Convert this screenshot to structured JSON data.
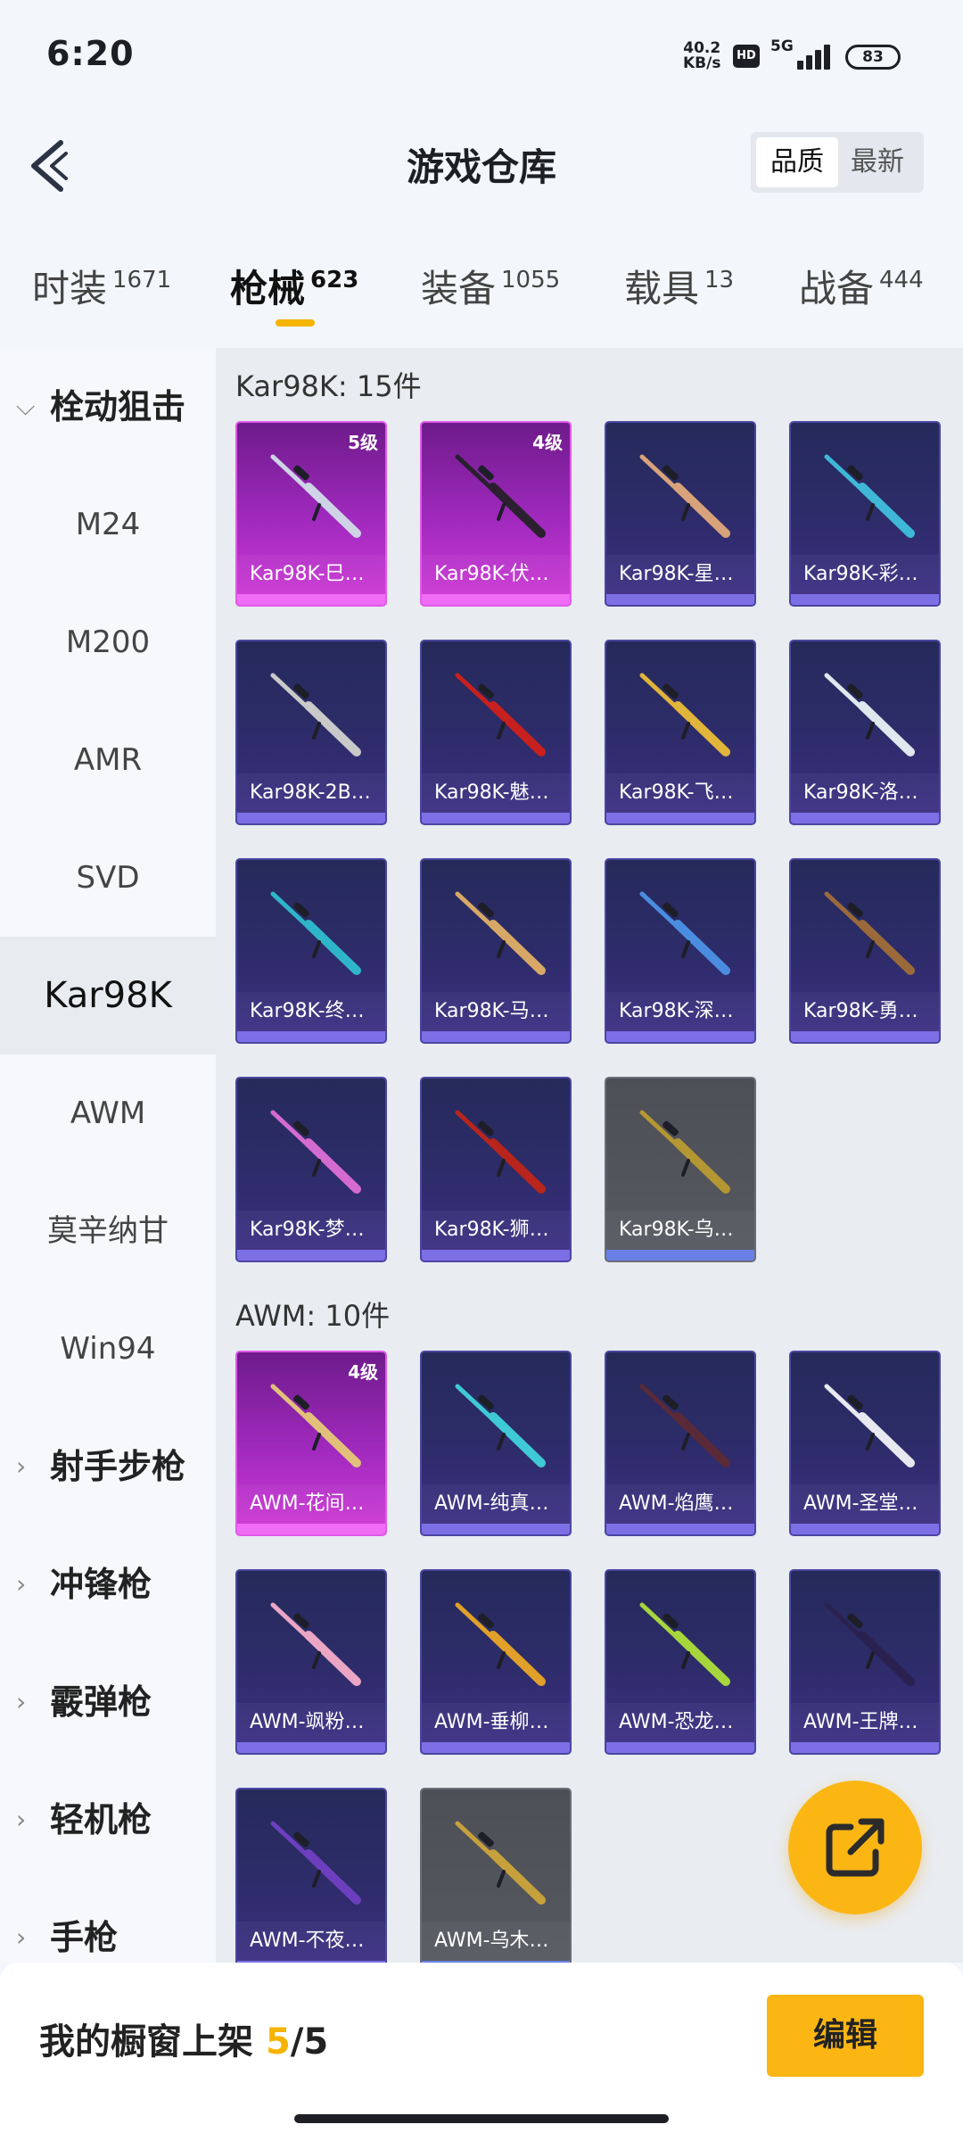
{
  "status": {
    "time": "6:20",
    "net_speed": "40.2",
    "net_unit": "KB/s",
    "hd": "HD",
    "gen": "5G",
    "battery": "83"
  },
  "header": {
    "title": "游戏仓库",
    "sort_quality": "品质",
    "sort_latest": "最新"
  },
  "tabs": [
    {
      "name": "时装",
      "count": "1671"
    },
    {
      "name": "枪械",
      "count": "623"
    },
    {
      "name": "装备",
      "count": "1055"
    },
    {
      "name": "载具",
      "count": "13"
    },
    {
      "name": "战备",
      "count": "444"
    }
  ],
  "active_tab": "枪械",
  "sidebar": {
    "items": [
      {
        "label": "栓动狙击",
        "group": true,
        "expanded": true
      },
      {
        "label": "M24"
      },
      {
        "label": "M200"
      },
      {
        "label": "AMR"
      },
      {
        "label": "SVD"
      },
      {
        "label": "Kar98K",
        "active": true
      },
      {
        "label": "AWM"
      },
      {
        "label": "莫辛纳甘"
      },
      {
        "label": "Win94"
      },
      {
        "label": "射手步枪",
        "group": true
      },
      {
        "label": "冲锋枪",
        "group": true
      },
      {
        "label": "霰弹枪",
        "group": true
      },
      {
        "label": "轻机枪",
        "group": true
      },
      {
        "label": "手枪",
        "group": true
      }
    ]
  },
  "sections": [
    {
      "title": "Kar98K: 15件",
      "items": [
        {
          "label": "Kar98K-巳…",
          "level": "5级",
          "rarity": "pink",
          "gun_color": "#cfd3e6"
        },
        {
          "label": "Kar98K-伏…",
          "level": "4级",
          "rarity": "pink",
          "gun_color": "#2a2030"
        },
        {
          "label": "Kar98K-星…",
          "rarity": "purple",
          "gun_color": "#d8a27a"
        },
        {
          "label": "Kar98K-彩…",
          "rarity": "purple",
          "gun_color": "#3fb8d8"
        },
        {
          "label": "Kar98K-2B…",
          "rarity": "purple",
          "gun_color": "#c9c9c9"
        },
        {
          "label": "Kar98K-魅…",
          "rarity": "purple",
          "gun_color": "#c8201e"
        },
        {
          "label": "Kar98K-飞…",
          "rarity": "purple",
          "gun_color": "#e1b43a"
        },
        {
          "label": "Kar98K-洛…",
          "rarity": "purple",
          "gun_color": "#dfe8ef"
        },
        {
          "label": "Kar98K-终…",
          "rarity": "purple",
          "gun_color": "#2fb5c9"
        },
        {
          "label": "Kar98K-马…",
          "rarity": "purple",
          "gun_color": "#d7a865"
        },
        {
          "label": "Kar98K-深…",
          "rarity": "purple",
          "gun_color": "#4a8de0"
        },
        {
          "label": "Kar98K-勇…",
          "rarity": "purple",
          "gun_color": "#9a6a3a"
        },
        {
          "label": "Kar98K-梦…",
          "rarity": "purple",
          "gun_color": "#d46bd1"
        },
        {
          "label": "Kar98K-狮…",
          "rarity": "purple",
          "gun_color": "#b8251c"
        },
        {
          "label": "Kar98K-乌…",
          "rarity": "grey",
          "gun_color": "#b49632"
        }
      ]
    },
    {
      "title": "AWM: 10件",
      "items": [
        {
          "label": "AWM-花间…",
          "level": "4级",
          "rarity": "pink",
          "gun_color": "#e2c07a"
        },
        {
          "label": "AWM-纯真…",
          "rarity": "purple",
          "gun_color": "#3fc9d6"
        },
        {
          "label": "AWM-焰鹰…",
          "rarity": "purple",
          "gun_color": "#5a2a38"
        },
        {
          "label": "AWM-圣堂…",
          "rarity": "purple",
          "gun_color": "#e8e8f0"
        },
        {
          "label": "AWM-飒粉…",
          "rarity": "purple",
          "gun_color": "#eaa6c4"
        },
        {
          "label": "AWM-垂柳…",
          "rarity": "purple",
          "gun_color": "#e0a02a"
        },
        {
          "label": "AWM-恐龙…",
          "rarity": "purple",
          "gun_color": "#a7d63c"
        },
        {
          "label": "AWM-王牌…",
          "rarity": "purple",
          "gun_color": "#2a2150"
        },
        {
          "label": "AWM-不夜…",
          "rarity": "purple",
          "gun_color": "#6d3fbf"
        },
        {
          "label": "AWM-乌木…",
          "rarity": "grey",
          "gun_color": "#c6a13b"
        }
      ]
    }
  ],
  "bottom": {
    "text": "我的橱窗上架",
    "current": "5",
    "sep": "/",
    "total": "5",
    "edit": "编辑"
  },
  "icons": {
    "back": "back-chevron-icon",
    "fab": "share-export-icon"
  }
}
